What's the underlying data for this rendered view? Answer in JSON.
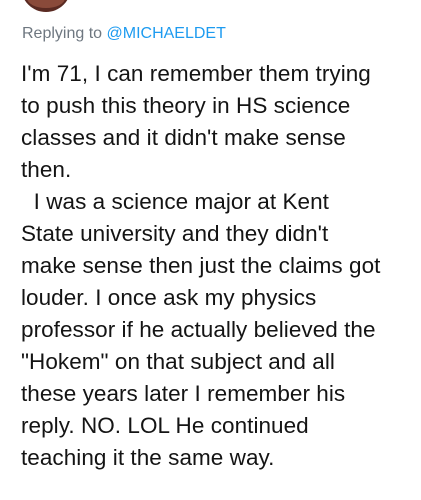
{
  "reply": {
    "prefix": "Replying to ",
    "handle": "@MICHAELDET"
  },
  "post": {
    "body": "I'm 71, I can remember them trying\nto push this theory in HS science\nclasses and it didn't make sense\nthen.\n  I was a science major at Kent\nState university and they didn't\nmake sense then just the claims got\nlouder. I once ask my physics\nprofessor if he actually believed the\n\"Hokem\" on that subject and all\nthese years later I remember his\nreply. NO. LOL He continued\nteaching it the same way."
  },
  "colors": {
    "handle": "#1d9bf0",
    "muted": "#6e7780",
    "text": "#141414"
  }
}
